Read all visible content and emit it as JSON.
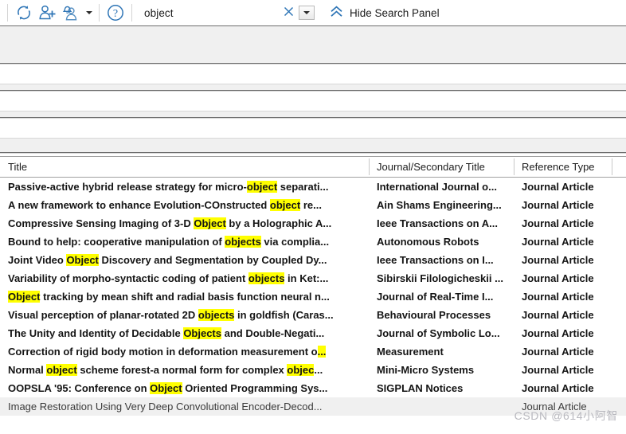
{
  "toolbar": {
    "icons": [
      {
        "name": "sync-refresh-icon",
        "title": "Sync"
      },
      {
        "name": "add-user-icon",
        "title": "Add user"
      },
      {
        "name": "user-alert-icon",
        "title": "User alerts"
      },
      {
        "name": "help-icon",
        "title": "Help"
      }
    ],
    "search": {
      "value": "object",
      "placeholder": "",
      "clear_icon": "close-icon",
      "dropdown_icon": "chevron-down-icon"
    },
    "hide_panel": {
      "icon": "double-chevron-up-icon",
      "label": "Hide Search Panel"
    },
    "accent_color": "#2e75b6"
  },
  "table": {
    "columns": [
      {
        "key": "title",
        "label": "Title"
      },
      {
        "key": "journal",
        "label": "Journal/Secondary Title"
      },
      {
        "key": "reftype",
        "label": "Reference Type"
      },
      {
        "key": "spare",
        "label": ""
      }
    ],
    "highlight_color": "#ffff00",
    "rows": [
      {
        "title_parts": [
          {
            "t": "Passive-active hybrid release strategy for micro-",
            "h": false
          },
          {
            "t": "object",
            "h": true
          },
          {
            "t": " separati...",
            "h": false
          }
        ],
        "journal": "International Journal o...",
        "reftype": "Journal Article",
        "read": false
      },
      {
        "title_parts": [
          {
            "t": "A new framework to enhance Evolution-COnstructed ",
            "h": false
          },
          {
            "t": "object",
            "h": true
          },
          {
            "t": " re...",
            "h": false
          }
        ],
        "journal": "Ain Shams Engineering...",
        "reftype": "Journal Article",
        "read": false
      },
      {
        "title_parts": [
          {
            "t": "Compressive Sensing Imaging of 3-D ",
            "h": false
          },
          {
            "t": "Object",
            "h": true
          },
          {
            "t": " by a Holographic A...",
            "h": false
          }
        ],
        "journal": "Ieee Transactions on A...",
        "reftype": "Journal Article",
        "read": false
      },
      {
        "title_parts": [
          {
            "t": "Bound to help: cooperative manipulation of ",
            "h": false
          },
          {
            "t": "objects",
            "h": true
          },
          {
            "t": " via complia...",
            "h": false
          }
        ],
        "journal": "Autonomous Robots",
        "reftype": "Journal Article",
        "read": false
      },
      {
        "title_parts": [
          {
            "t": "Joint Video ",
            "h": false
          },
          {
            "t": "Object",
            "h": true
          },
          {
            "t": " Discovery and Segmentation by Coupled Dy...",
            "h": false
          }
        ],
        "journal": "Ieee Transactions on I...",
        "reftype": "Journal Article",
        "read": false
      },
      {
        "title_parts": [
          {
            "t": "Variability of morpho-syntactic coding of patient ",
            "h": false
          },
          {
            "t": "objects",
            "h": true
          },
          {
            "t": " in Ket:...",
            "h": false
          }
        ],
        "journal": "Sibirskii Filologicheskii ...",
        "reftype": "Journal Article",
        "read": false
      },
      {
        "title_parts": [
          {
            "t": "Object",
            "h": true
          },
          {
            "t": " tracking by mean shift and radial basis function neural n...",
            "h": false
          }
        ],
        "journal": "Journal of Real-Time I...",
        "reftype": "Journal Article",
        "read": false
      },
      {
        "title_parts": [
          {
            "t": "Visual perception of planar-rotated 2D ",
            "h": false
          },
          {
            "t": "objects",
            "h": true
          },
          {
            "t": " in goldfish (Caras...",
            "h": false
          }
        ],
        "journal": "Behavioural Processes",
        "reftype": "Journal Article",
        "read": false
      },
      {
        "title_parts": [
          {
            "t": "The Unity and Identity of Decidable ",
            "h": false
          },
          {
            "t": "Objects",
            "h": true
          },
          {
            "t": " and Double-Negati...",
            "h": false
          }
        ],
        "journal": "Journal of Symbolic Lo...",
        "reftype": "Journal Article",
        "read": false
      },
      {
        "title_parts": [
          {
            "t": "Correction of rigid body motion in deformation measurement o",
            "h": false
          },
          {
            "t": "...",
            "h": true
          }
        ],
        "journal": "Measurement",
        "reftype": "Journal Article",
        "read": false
      },
      {
        "title_parts": [
          {
            "t": "Normal ",
            "h": false
          },
          {
            "t": "object",
            "h": true
          },
          {
            "t": " scheme forest-a normal form for complex ",
            "h": false
          },
          {
            "t": "objec",
            "h": true
          },
          {
            "t": "...",
            "h": false
          }
        ],
        "journal": "Mini-Micro Systems",
        "reftype": "Journal Article",
        "read": false
      },
      {
        "title_parts": [
          {
            "t": "OOPSLA '95: Conference on ",
            "h": false
          },
          {
            "t": "Object",
            "h": true
          },
          {
            "t": " Oriented Programming Sys...",
            "h": false
          }
        ],
        "journal": "SIGPLAN Notices",
        "reftype": "Journal Article",
        "read": false
      },
      {
        "title_parts": [
          {
            "t": "Image Restoration Using Very Deep Convolutional Encoder-Decod...",
            "h": false
          }
        ],
        "journal": "",
        "reftype": "Journal Article",
        "read": true
      }
    ]
  },
  "watermark": "CSDN @614小阿智"
}
